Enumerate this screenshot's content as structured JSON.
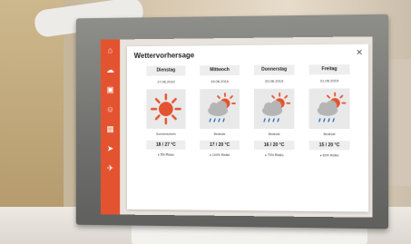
{
  "dialog": {
    "title": "Wettervorhersage",
    "close_label": "✕"
  },
  "sidebar": {
    "items": [
      {
        "icon": "home-icon",
        "glyph": "⌂"
      },
      {
        "icon": "cloud-icon",
        "glyph": "☁"
      },
      {
        "icon": "transport-icon",
        "glyph": "▣"
      },
      {
        "icon": "people-icon",
        "glyph": "☺"
      },
      {
        "icon": "calendar-icon",
        "glyph": "▦"
      },
      {
        "icon": "send-icon",
        "glyph": "➤"
      },
      {
        "icon": "plane-icon",
        "glyph": "✈"
      }
    ]
  },
  "days": [
    {
      "name": "Dienstag",
      "date": "17.06.2019",
      "icon": "sun-icon",
      "desc": "Sonnenschein",
      "temp": "18 / 27 °C",
      "rain": "5% Risiko"
    },
    {
      "name": "Mittwoch",
      "date": "19.06.2019",
      "icon": "sun-cloud-rain-icon",
      "desc": "Bedeckt",
      "temp": "17 / 20 °C",
      "rain": "100% Risiko"
    },
    {
      "name": "Donnerstag",
      "date": "20.06.2019",
      "icon": "sun-cloud-rain-icon",
      "desc": "Bedeckt",
      "temp": "16 / 20 °C",
      "rain": "70% Risiko"
    },
    {
      "name": "Freitag",
      "date": "21.06.2019",
      "icon": "sun-cloud-rain-icon",
      "desc": "Bedeckt",
      "temp": "15 / 20 °C",
      "rain": "60% Risiko"
    }
  ],
  "colors": {
    "sidebar": "#e4532f",
    "sun": "#e4532f",
    "cloud": "#b5b5b5",
    "rain": "#2c6fb7"
  }
}
